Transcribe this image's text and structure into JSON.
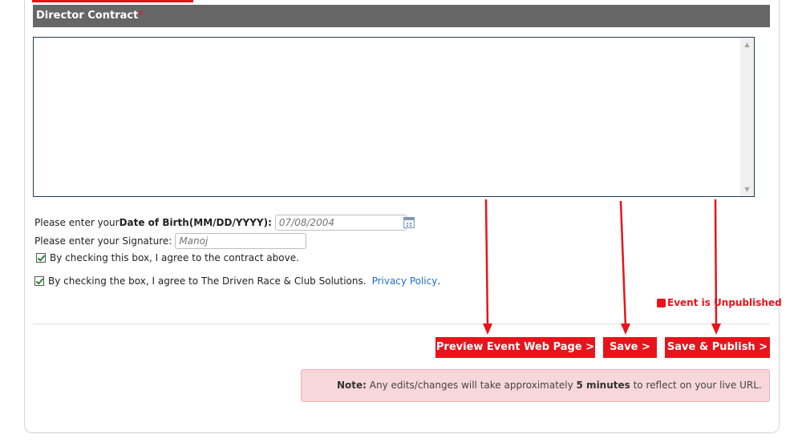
{
  "section": {
    "title": "Director Contract",
    "required_marker": "*"
  },
  "form": {
    "dob_label_prefix": "Please enter your ",
    "dob_label_bold": "Date of Birth(MM/DD/YYYY):",
    "dob_placeholder": "07/08/2004",
    "signature_label": "Please enter your Signature:",
    "signature_placeholder": "Manoj",
    "agree_contract": "By checking this box, I agree to the contract above.",
    "agree_terms": "By checking the box, I agree to The Driven Race & Club Solutions.",
    "privacy_link": "Privacy Policy",
    "privacy_suffix": "."
  },
  "status": {
    "text": "Event is Unpublished",
    "color": "#e8141b"
  },
  "actions": {
    "preview_label": "Preview Event Web Page >",
    "save_label": "Save >",
    "publish_label": "Save & Publish >"
  },
  "note": {
    "prefix": "Note:",
    "text_1": " Any edits/changes will take approximately ",
    "bold": "5 minutes",
    "text_2": " to reflect on your live URL."
  },
  "colors": {
    "accent": "#e8141b",
    "header_bg": "#666666",
    "note_bg": "#f8d7da",
    "link": "#1f6fc9"
  }
}
